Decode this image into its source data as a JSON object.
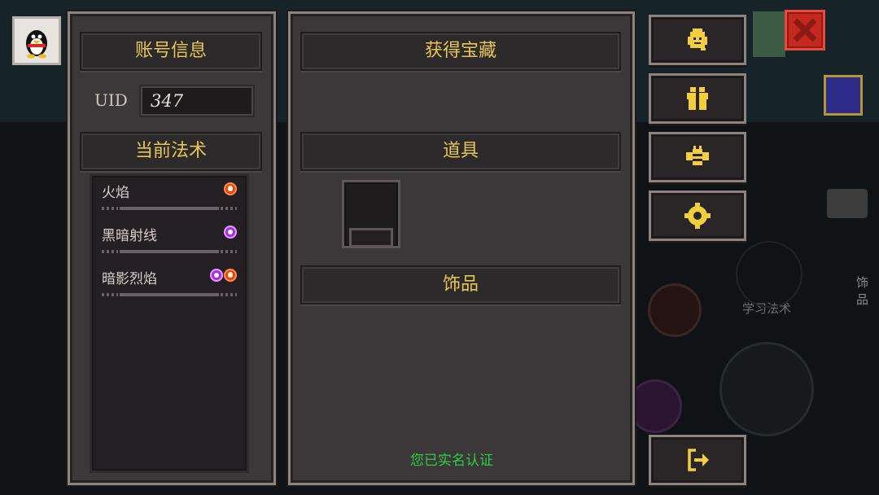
{
  "account_panel": {
    "title": "账号信息",
    "uid_label": "UID",
    "uid_value": "347",
    "spell_title": "当前法术",
    "spells": [
      {
        "name": "火焰",
        "elements": [
          "fire"
        ]
      },
      {
        "name": "黑暗射线",
        "elements": [
          "dark"
        ]
      },
      {
        "name": "暗影烈焰",
        "elements": [
          "dark",
          "fire"
        ]
      }
    ]
  },
  "treasure_panel": {
    "title": "获得宝藏",
    "items_title": "道具",
    "accessories_title": "饰品",
    "verified_text": "您已实名认证"
  },
  "side_buttons": [
    {
      "icon": "headset-support-icon"
    },
    {
      "icon": "gift-icon"
    },
    {
      "icon": "bee-icon"
    },
    {
      "icon": "gear-icon"
    }
  ],
  "exit_button": {
    "icon": "exit-icon"
  },
  "close_button": {
    "icon": "close-x-icon"
  },
  "background": {
    "hud_text_accessory": "饰品",
    "hud_text_spell": "学习法术"
  },
  "colors": {
    "header_text": "#e8c655",
    "verified_text": "#2ecc40",
    "panel_bg": "#3c3839",
    "close_button": "#c4281f"
  }
}
